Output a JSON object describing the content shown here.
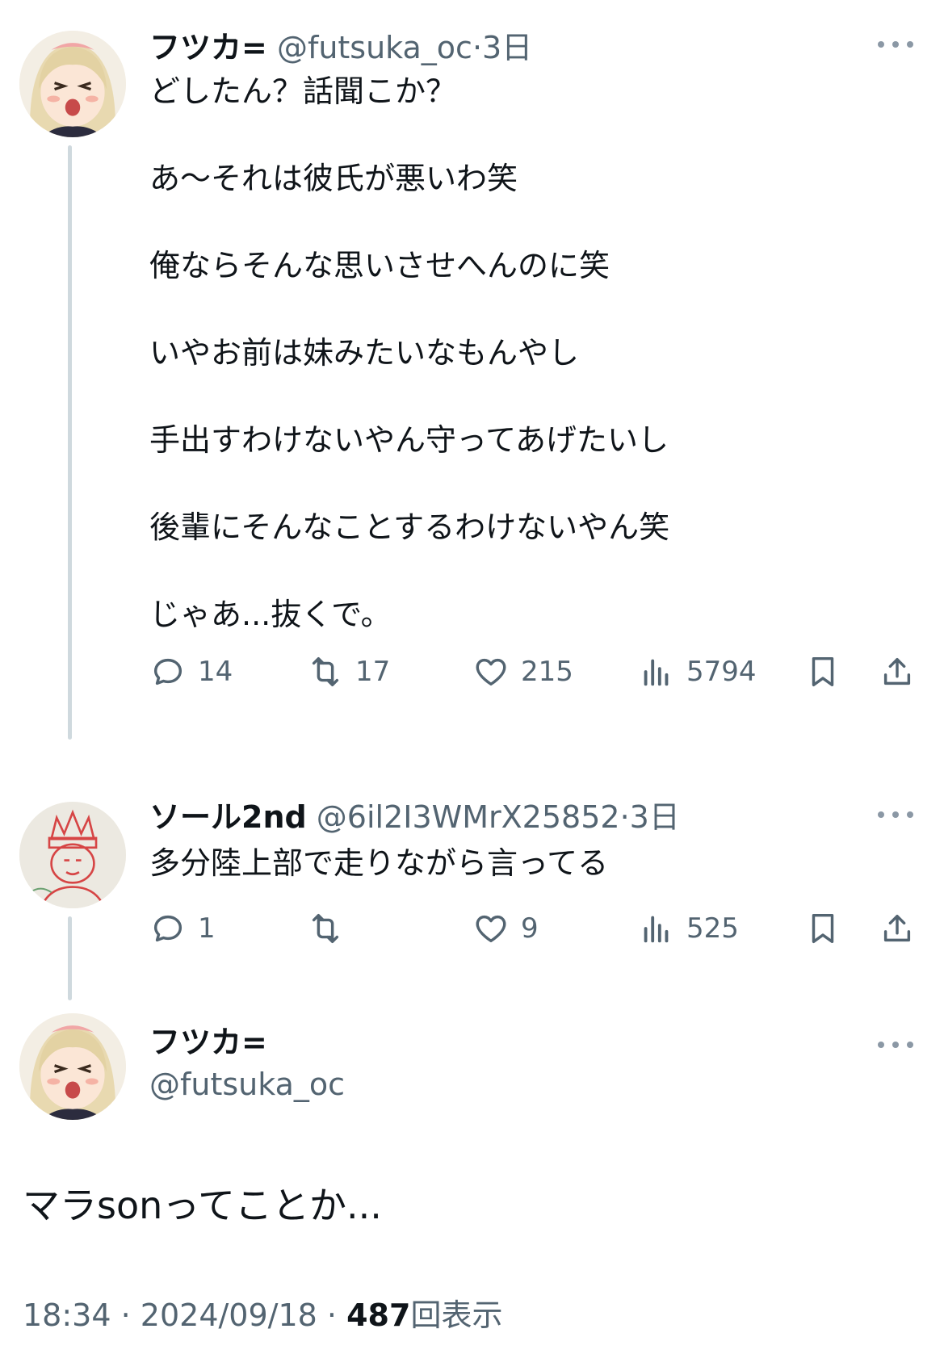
{
  "tweet1": {
    "name": "フツカ=",
    "handle": "@futsuka_oc",
    "separator": "·",
    "time": "3日",
    "lines": [
      "どしたん？話聞こか？",
      "あ〜それは彼氏が悪いわ笑",
      "俺ならそんな思いさせへんのに笑",
      "いやお前は妹みたいなもんやし",
      "手出すわけないやん守ってあげたいし",
      "後輩にそんなことするわけないやん笑",
      "じゃあ...抜くで。"
    ],
    "replies": "14",
    "retweets": "17",
    "likes": "215",
    "views": "5794"
  },
  "tweet2": {
    "name": "ソール2nd",
    "handle": "@6il2I3WMrX25852",
    "separator": "·",
    "time": "3日",
    "lines": [
      "多分陸上部で走りながら言ってる"
    ],
    "replies": "1",
    "retweets": "",
    "likes": "9",
    "views": "525"
  },
  "main": {
    "name": "フツカ=",
    "handle": "@futsuka_oc",
    "text": "マラsonってことか...",
    "time": "18:34",
    "date": "2024/09/18",
    "dot": "·",
    "views": "487",
    "views_label": "回表示"
  },
  "icons": {
    "reply": "reply-icon",
    "retweet": "retweet-icon",
    "like": "heart-icon",
    "views": "views-icon",
    "bookmark": "bookmark-icon",
    "share": "share-icon",
    "more": "more-icon"
  },
  "colors": {
    "text": "#0f1419",
    "muted": "#536471",
    "thread": "#cfd9de"
  }
}
